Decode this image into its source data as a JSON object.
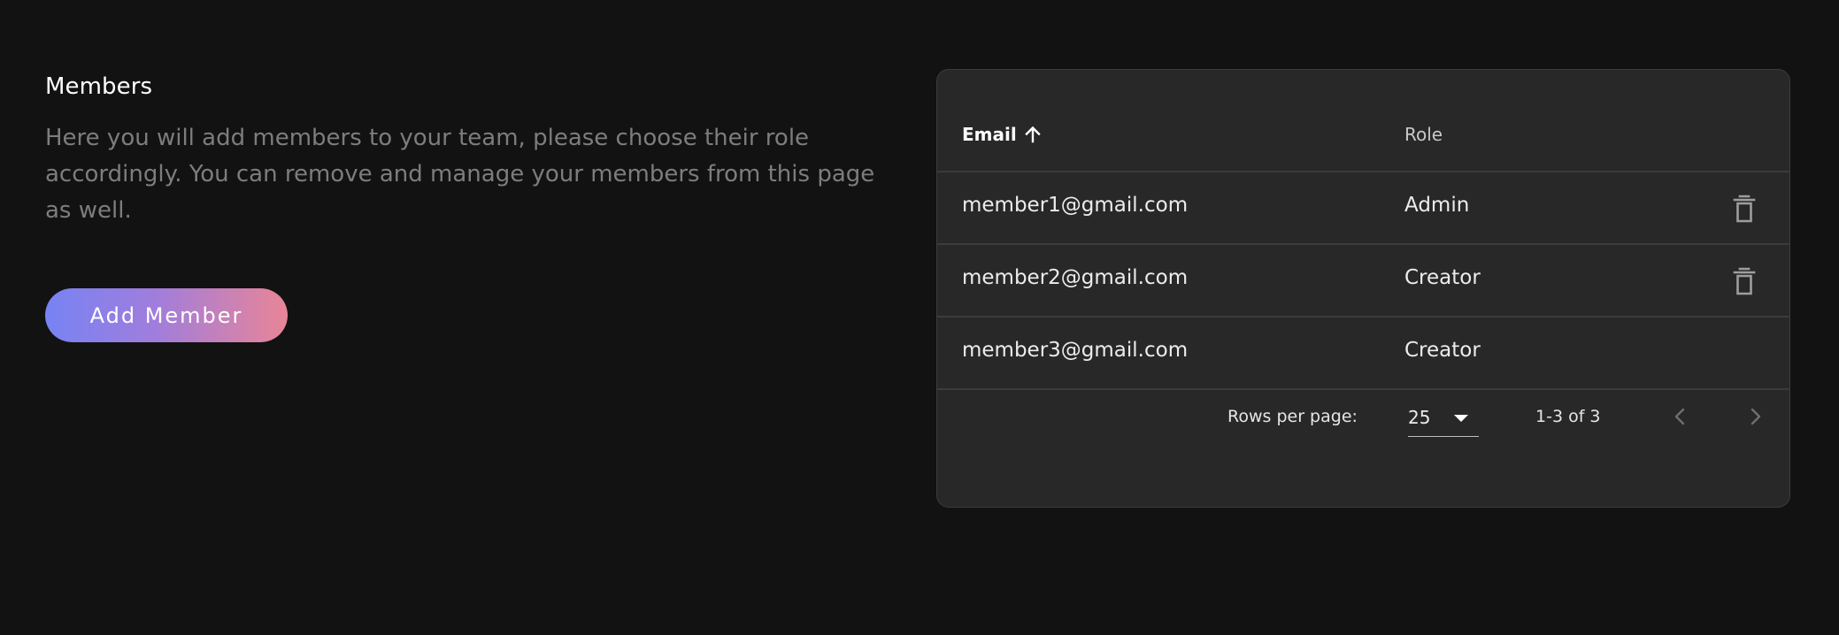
{
  "members_section": {
    "title": "Members",
    "description": "Here you will add members to your team, please choose their role accordingly. You can remove and manage your members from this page as well.",
    "add_button_label": "Add Member"
  },
  "table": {
    "columns": {
      "email": "Email",
      "role": "Role"
    },
    "sort": {
      "column": "email",
      "direction": "ascending",
      "icon": "arrow-up-icon"
    },
    "rows": [
      {
        "email": "member1@gmail.com",
        "role": "Admin",
        "deletable": true
      },
      {
        "email": "member2@gmail.com",
        "role": "Creator",
        "deletable": true
      },
      {
        "email": "member3@gmail.com",
        "role": "Creator",
        "deletable": false
      }
    ],
    "row_action_icon": "trash-icon"
  },
  "pagination": {
    "rows_per_page_label": "Rows per page:",
    "rows_per_page_value": "25",
    "range_text": "1-3 of 3",
    "prev_icon": "chevron-left-icon",
    "next_icon": "chevron-right-icon"
  },
  "colors": {
    "background": "#121212",
    "card": "#282828",
    "divider": "#3b3b3b",
    "text_primary": "#ececec",
    "text_muted": "#7d7d7d",
    "button_gradient_start": "#7783f4",
    "button_gradient_end": "#e98597"
  }
}
